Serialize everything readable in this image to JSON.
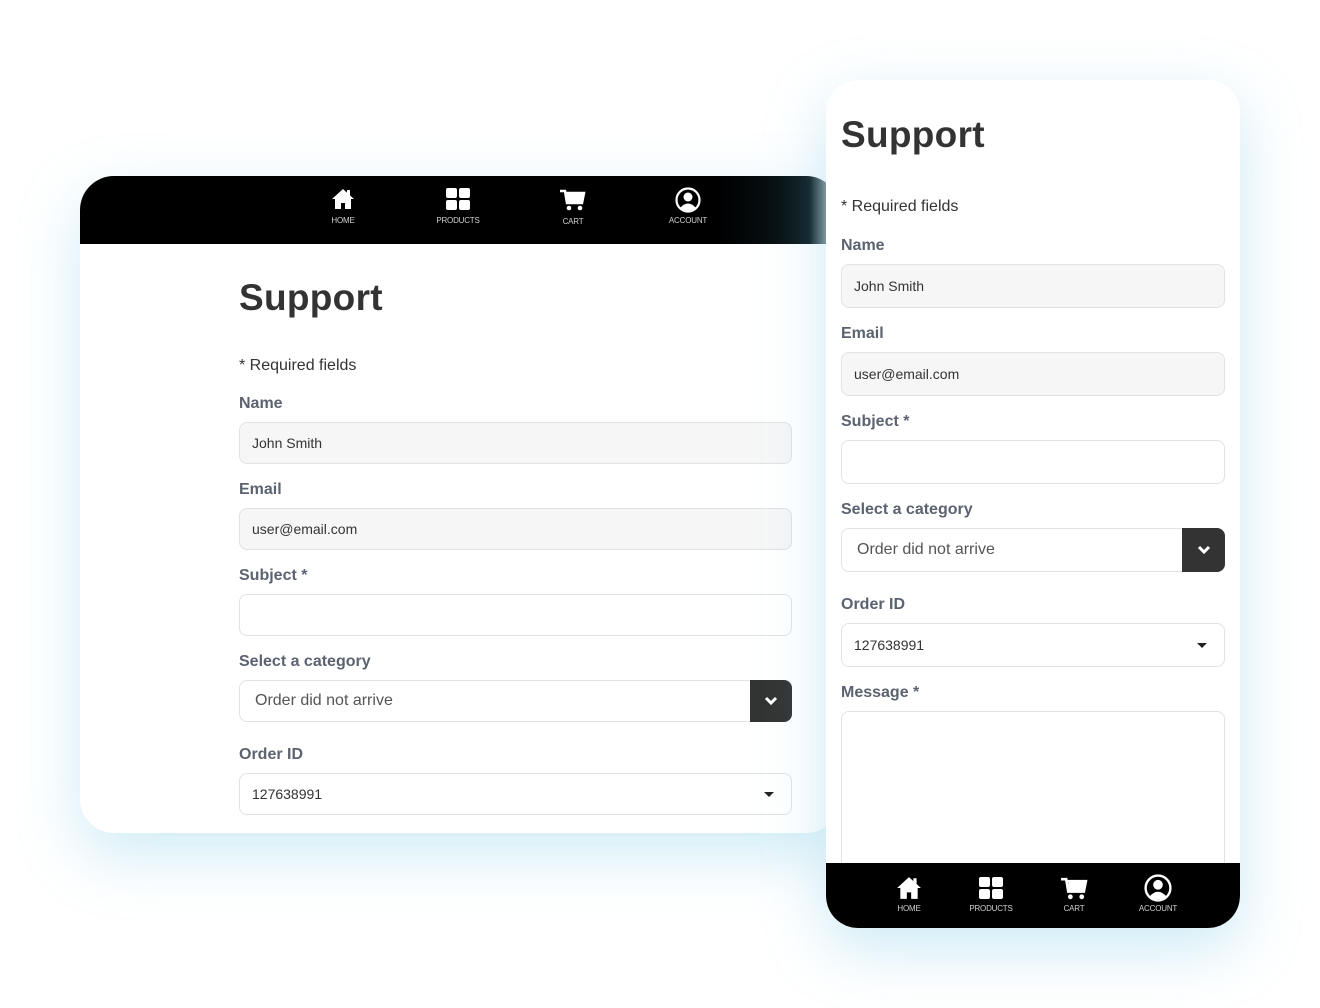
{
  "nav": {
    "items": [
      {
        "label": "HOME",
        "icon": "home-icon"
      },
      {
        "label": "PRODUCTS",
        "icon": "grid-icon"
      },
      {
        "label": "CART",
        "icon": "cart-icon"
      },
      {
        "label": "ACCOUNT",
        "icon": "account-icon"
      }
    ]
  },
  "form": {
    "title": "Support",
    "required_note": "* Required fields",
    "name": {
      "label": "Name",
      "value": "John Smith"
    },
    "email": {
      "label": "Email",
      "value": "user@email.com"
    },
    "subject": {
      "label": "Subject *",
      "value": ""
    },
    "category": {
      "label": "Select a category",
      "value": "Order did not arrive"
    },
    "order_id": {
      "label": "Order ID",
      "value": "127638991"
    },
    "message": {
      "label": "Message *",
      "value": ""
    }
  },
  "colors": {
    "nav_bg": "#000000",
    "title": "#333333",
    "label": "#5c6370",
    "readonly_bg": "#f6f6f6",
    "select_button": "#333333",
    "shadow_tint": "#bfe6f2"
  }
}
